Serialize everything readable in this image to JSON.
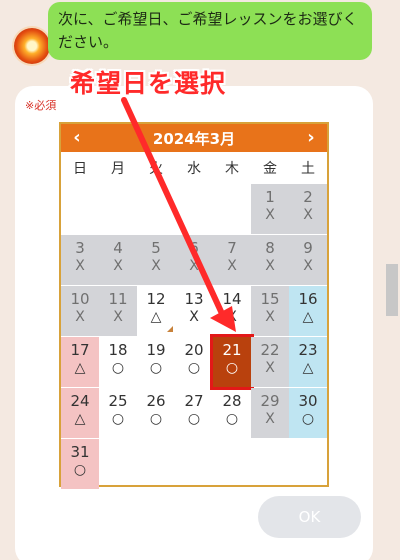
{
  "chat": {
    "message": "次に、ご希望日、ご希望レッスンをお選びください。"
  },
  "form": {
    "required_label": "※必須",
    "ok_label": "OK"
  },
  "annotation": {
    "text": "希望日を選択",
    "color": "#ff2a2a"
  },
  "calendar": {
    "title": "2024年3月",
    "prev_label": "‹",
    "next_label": "›",
    "weekdays": [
      "日",
      "月",
      "火",
      "水",
      "木",
      "金",
      "土"
    ],
    "selected_day": "21",
    "weeks": [
      [
        null,
        null,
        null,
        null,
        null,
        {
          "day": "1",
          "sym": "X",
          "state": "past"
        },
        {
          "day": "2",
          "sym": "X",
          "state": "past"
        }
      ],
      [
        {
          "day": "3",
          "sym": "X",
          "state": "past"
        },
        {
          "day": "4",
          "sym": "X",
          "state": "past"
        },
        {
          "day": "5",
          "sym": "X",
          "state": "past"
        },
        {
          "day": "6",
          "sym": "X",
          "state": "past"
        },
        {
          "day": "7",
          "sym": "X",
          "state": "past"
        },
        {
          "day": "8",
          "sym": "X",
          "state": "past"
        },
        {
          "day": "9",
          "sym": "X",
          "state": "past"
        }
      ],
      [
        {
          "day": "10",
          "sym": "X",
          "state": "past"
        },
        {
          "day": "11",
          "sym": "X",
          "state": "past"
        },
        {
          "day": "12",
          "sym": "△",
          "state": "open"
        },
        {
          "day": "13",
          "sym": "X",
          "state": "open"
        },
        {
          "day": "14",
          "sym": "X",
          "state": "open"
        },
        {
          "day": "15",
          "sym": "X",
          "state": "past"
        },
        {
          "day": "16",
          "sym": "△",
          "state": "sat"
        }
      ],
      [
        {
          "day": "17",
          "sym": "△",
          "state": "sun"
        },
        {
          "day": "18",
          "sym": "○",
          "state": "open"
        },
        {
          "day": "19",
          "sym": "○",
          "state": "open"
        },
        {
          "day": "20",
          "sym": "○",
          "state": "open"
        },
        {
          "day": "21",
          "sym": "○",
          "state": "sel"
        },
        {
          "day": "22",
          "sym": "X",
          "state": "past"
        },
        {
          "day": "23",
          "sym": "△",
          "state": "sat"
        }
      ],
      [
        {
          "day": "24",
          "sym": "△",
          "state": "sun"
        },
        {
          "day": "25",
          "sym": "○",
          "state": "open"
        },
        {
          "day": "26",
          "sym": "○",
          "state": "open"
        },
        {
          "day": "27",
          "sym": "○",
          "state": "open"
        },
        {
          "day": "28",
          "sym": "○",
          "state": "open"
        },
        {
          "day": "29",
          "sym": "X",
          "state": "past"
        },
        {
          "day": "30",
          "sym": "○",
          "state": "sat"
        }
      ],
      [
        {
          "day": "31",
          "sym": "○",
          "state": "sun"
        },
        null,
        null,
        null,
        null,
        null,
        null
      ]
    ]
  },
  "colors": {
    "header": "#e8731a",
    "bubble": "#8de055",
    "selected": "#b9410d",
    "past": "#d3d4d8",
    "sunday": "#f4c3c3",
    "saturday": "#bfe5f2"
  }
}
